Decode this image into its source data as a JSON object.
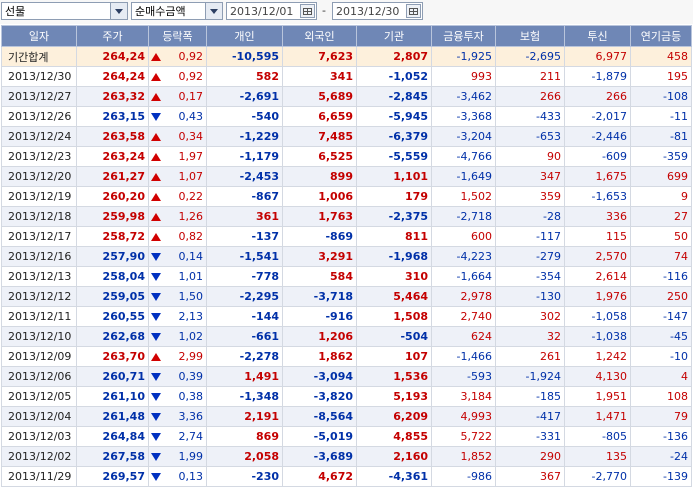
{
  "toolbar": {
    "market": "선물",
    "metric": "순매수금액",
    "start_date": "2013/12/01",
    "end_date": "2013/12/30",
    "separator": "-"
  },
  "colors": {
    "up": "#c40000",
    "down": "#0030a8",
    "header": "#6f87b6"
  },
  "table": {
    "columns": [
      "일자",
      "주가",
      "등락폭",
      "개인",
      "외국인",
      "기관",
      "금융투자",
      "보험",
      "투신",
      "연기금등"
    ],
    "summary": {
      "date": "기간합계",
      "price": "264,24",
      "dir": "up",
      "change": "0,92",
      "individual": "-10,595",
      "foreign": "7,623",
      "institution": "2,807",
      "fin_invest": "-1,925",
      "insurance": "-2,695",
      "trust": "6,977",
      "pension": "458"
    },
    "rows": [
      {
        "date": "2013/12/30",
        "price": "264,24",
        "dir": "up",
        "change": "0,92",
        "individual": "582",
        "foreign": "341",
        "institution": "-1,052",
        "fin_invest": "993",
        "insurance": "211",
        "trust": "-1,879",
        "pension": "195"
      },
      {
        "date": "2013/12/27",
        "price": "263,32",
        "dir": "up",
        "change": "0,17",
        "individual": "-2,691",
        "foreign": "5,689",
        "institution": "-2,845",
        "fin_invest": "-3,462",
        "insurance": "266",
        "trust": "266",
        "pension": "-108"
      },
      {
        "date": "2013/12/26",
        "price": "263,15",
        "dir": "down",
        "change": "0,43",
        "individual": "-540",
        "foreign": "6,659",
        "institution": "-5,945",
        "fin_invest": "-3,368",
        "insurance": "-433",
        "trust": "-2,017",
        "pension": "-11"
      },
      {
        "date": "2013/12/24",
        "price": "263,58",
        "dir": "up",
        "change": "0,34",
        "individual": "-1,229",
        "foreign": "7,485",
        "institution": "-6,379",
        "fin_invest": "-3,204",
        "insurance": "-653",
        "trust": "-2,446",
        "pension": "-81"
      },
      {
        "date": "2013/12/23",
        "price": "263,24",
        "dir": "up",
        "change": "1,97",
        "individual": "-1,179",
        "foreign": "6,525",
        "institution": "-5,559",
        "fin_invest": "-4,766",
        "insurance": "90",
        "trust": "-609",
        "pension": "-359"
      },
      {
        "date": "2013/12/20",
        "price": "261,27",
        "dir": "up",
        "change": "1,07",
        "individual": "-2,453",
        "foreign": "899",
        "institution": "1,101",
        "fin_invest": "-1,649",
        "insurance": "347",
        "trust": "1,675",
        "pension": "699"
      },
      {
        "date": "2013/12/19",
        "price": "260,20",
        "dir": "up",
        "change": "0,22",
        "individual": "-867",
        "foreign": "1,006",
        "institution": "179",
        "fin_invest": "1,502",
        "insurance": "359",
        "trust": "-1,653",
        "pension": "9"
      },
      {
        "date": "2013/12/18",
        "price": "259,98",
        "dir": "up",
        "change": "1,26",
        "individual": "361",
        "foreign": "1,763",
        "institution": "-2,375",
        "fin_invest": "-2,718",
        "insurance": "-28",
        "trust": "336",
        "pension": "27"
      },
      {
        "date": "2013/12/17",
        "price": "258,72",
        "dir": "up",
        "change": "0,82",
        "individual": "-137",
        "foreign": "-869",
        "institution": "811",
        "fin_invest": "600",
        "insurance": "-117",
        "trust": "115",
        "pension": "50"
      },
      {
        "date": "2013/12/16",
        "price": "257,90",
        "dir": "down",
        "change": "0,14",
        "individual": "-1,541",
        "foreign": "3,291",
        "institution": "-1,968",
        "fin_invest": "-4,223",
        "insurance": "-279",
        "trust": "2,570",
        "pension": "74"
      },
      {
        "date": "2013/12/13",
        "price": "258,04",
        "dir": "down",
        "change": "1,01",
        "individual": "-778",
        "foreign": "584",
        "institution": "310",
        "fin_invest": "-1,664",
        "insurance": "-354",
        "trust": "2,614",
        "pension": "-116"
      },
      {
        "date": "2013/12/12",
        "price": "259,05",
        "dir": "down",
        "change": "1,50",
        "individual": "-2,295",
        "foreign": "-3,718",
        "institution": "5,464",
        "fin_invest": "2,978",
        "insurance": "-130",
        "trust": "1,976",
        "pension": "250"
      },
      {
        "date": "2013/12/11",
        "price": "260,55",
        "dir": "down",
        "change": "2,13",
        "individual": "-144",
        "foreign": "-916",
        "institution": "1,508",
        "fin_invest": "2,740",
        "insurance": "302",
        "trust": "-1,058",
        "pension": "-147"
      },
      {
        "date": "2013/12/10",
        "price": "262,68",
        "dir": "down",
        "change": "1,02",
        "individual": "-661",
        "foreign": "1,206",
        "institution": "-504",
        "fin_invest": "624",
        "insurance": "32",
        "trust": "-1,038",
        "pension": "-45"
      },
      {
        "date": "2013/12/09",
        "price": "263,70",
        "dir": "up",
        "change": "2,99",
        "individual": "-2,278",
        "foreign": "1,862",
        "institution": "107",
        "fin_invest": "-1,466",
        "insurance": "261",
        "trust": "1,242",
        "pension": "-10"
      },
      {
        "date": "2013/12/06",
        "price": "260,71",
        "dir": "down",
        "change": "0,39",
        "individual": "1,491",
        "foreign": "-3,094",
        "institution": "1,536",
        "fin_invest": "-593",
        "insurance": "-1,924",
        "trust": "4,130",
        "pension": "4"
      },
      {
        "date": "2013/12/05",
        "price": "261,10",
        "dir": "down",
        "change": "0,38",
        "individual": "-1,348",
        "foreign": "-3,820",
        "institution": "5,193",
        "fin_invest": "3,184",
        "insurance": "-185",
        "trust": "1,951",
        "pension": "108"
      },
      {
        "date": "2013/12/04",
        "price": "261,48",
        "dir": "down",
        "change": "3,36",
        "individual": "2,191",
        "foreign": "-8,564",
        "institution": "6,209",
        "fin_invest": "4,993",
        "insurance": "-417",
        "trust": "1,471",
        "pension": "79"
      },
      {
        "date": "2013/12/03",
        "price": "264,84",
        "dir": "down",
        "change": "2,74",
        "individual": "869",
        "foreign": "-5,019",
        "institution": "4,855",
        "fin_invest": "5,722",
        "insurance": "-331",
        "trust": "-805",
        "pension": "-136"
      },
      {
        "date": "2013/12/02",
        "price": "267,58",
        "dir": "down",
        "change": "1,99",
        "individual": "2,058",
        "foreign": "-3,689",
        "institution": "2,160",
        "fin_invest": "1,852",
        "insurance": "290",
        "trust": "135",
        "pension": "-24"
      },
      {
        "date": "2013/11/29",
        "price": "269,57",
        "dir": "down",
        "change": "0,13",
        "individual": "-230",
        "foreign": "4,672",
        "institution": "-4,361",
        "fin_invest": "-986",
        "insurance": "367",
        "trust": "-2,770",
        "pension": "-139"
      }
    ]
  }
}
